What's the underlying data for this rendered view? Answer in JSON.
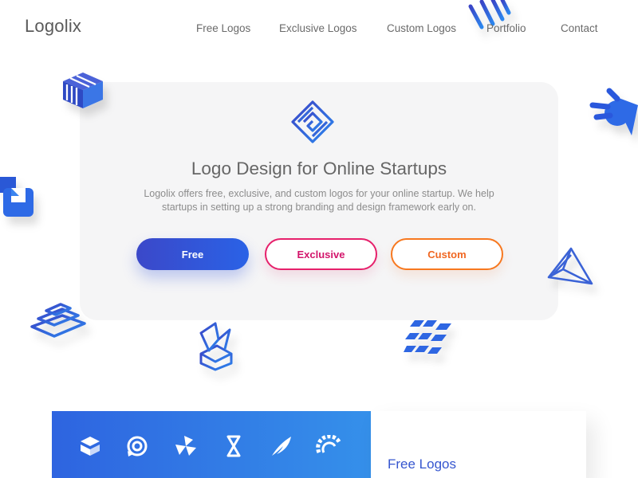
{
  "header": {
    "logo": "Logolix",
    "nav": [
      "Free Logos",
      "Exclusive Logos",
      "Custom Logos",
      "Portfolio",
      "Contact"
    ]
  },
  "hero": {
    "title": "Logo Design for Online Startups",
    "description_line1": "Logolix offers free, exclusive, and custom logos for your online startup. We help",
    "description_line2": "startups in setting up a strong branding and design framework early on.",
    "buttons": {
      "free": "Free",
      "exclusive": "Exclusive",
      "custom": "Custom"
    }
  },
  "colors": {
    "primary_blue": "#2a62e6",
    "exclusive_pink": "#e6206b",
    "custom_orange": "#f7781f",
    "card_bg": "#f5f5f6"
  },
  "decorative_icons": [
    "striped-cube-icon",
    "speed-lines-icon",
    "comet-icon",
    "squares-icon",
    "prism-icon",
    "stacked-layers-icon",
    "crystal-box-icon",
    "flag-tiles-icon",
    "maze-square-icon"
  ],
  "free_logos_section": {
    "title": "Free Logos",
    "banner_icons": [
      "striped-box-icon",
      "target-bubble-icon",
      "pinwheel-icon",
      "hourglass-icon",
      "wing-icon",
      "gear-arc-icon"
    ]
  }
}
